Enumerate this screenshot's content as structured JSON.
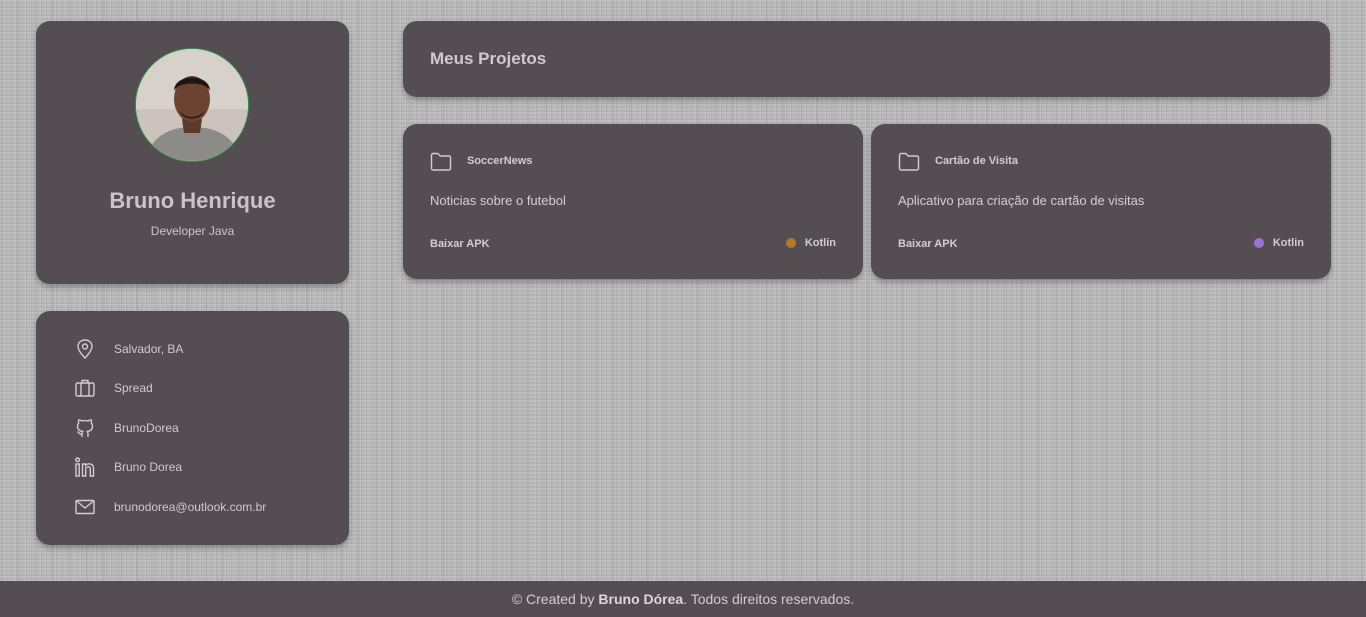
{
  "profile": {
    "name": "Bruno Henrique",
    "role": "Developer Java",
    "avatar_icon": "user-photo",
    "avatar_border_color": "#2e9a47"
  },
  "info": {
    "items": [
      {
        "icon": "location-icon",
        "label": "Salvador, BA"
      },
      {
        "icon": "briefcase-icon",
        "label": "Spread"
      },
      {
        "icon": "github-icon",
        "label": "BrunoDorea"
      },
      {
        "icon": "linkedin-icon",
        "label": "Bruno Dorea"
      },
      {
        "icon": "mail-icon",
        "label": "brunodorea@outlook.com.br"
      }
    ]
  },
  "projects": {
    "title": "Meus Projetos",
    "items": [
      {
        "name": "SoccerNews",
        "description": "Noticias sobre o futebol",
        "download_label": "Baixar APK",
        "language": "Kotlin",
        "language_color": "#b07a2a"
      },
      {
        "name": "Cartão de Visita",
        "description": "Aplicativo para criação de cartão de visitas",
        "download_label": "Baixar APK",
        "language": "Kotlin",
        "language_color": "#9b72d9"
      }
    ]
  },
  "footer": {
    "prefix": "© Created by ",
    "author": "Bruno Dórea",
    "suffix": ". Todos direitos reservados."
  },
  "colors": {
    "card_background": "#544e52",
    "page_background": "#b9b9b9",
    "text": "#d2cdd0"
  }
}
